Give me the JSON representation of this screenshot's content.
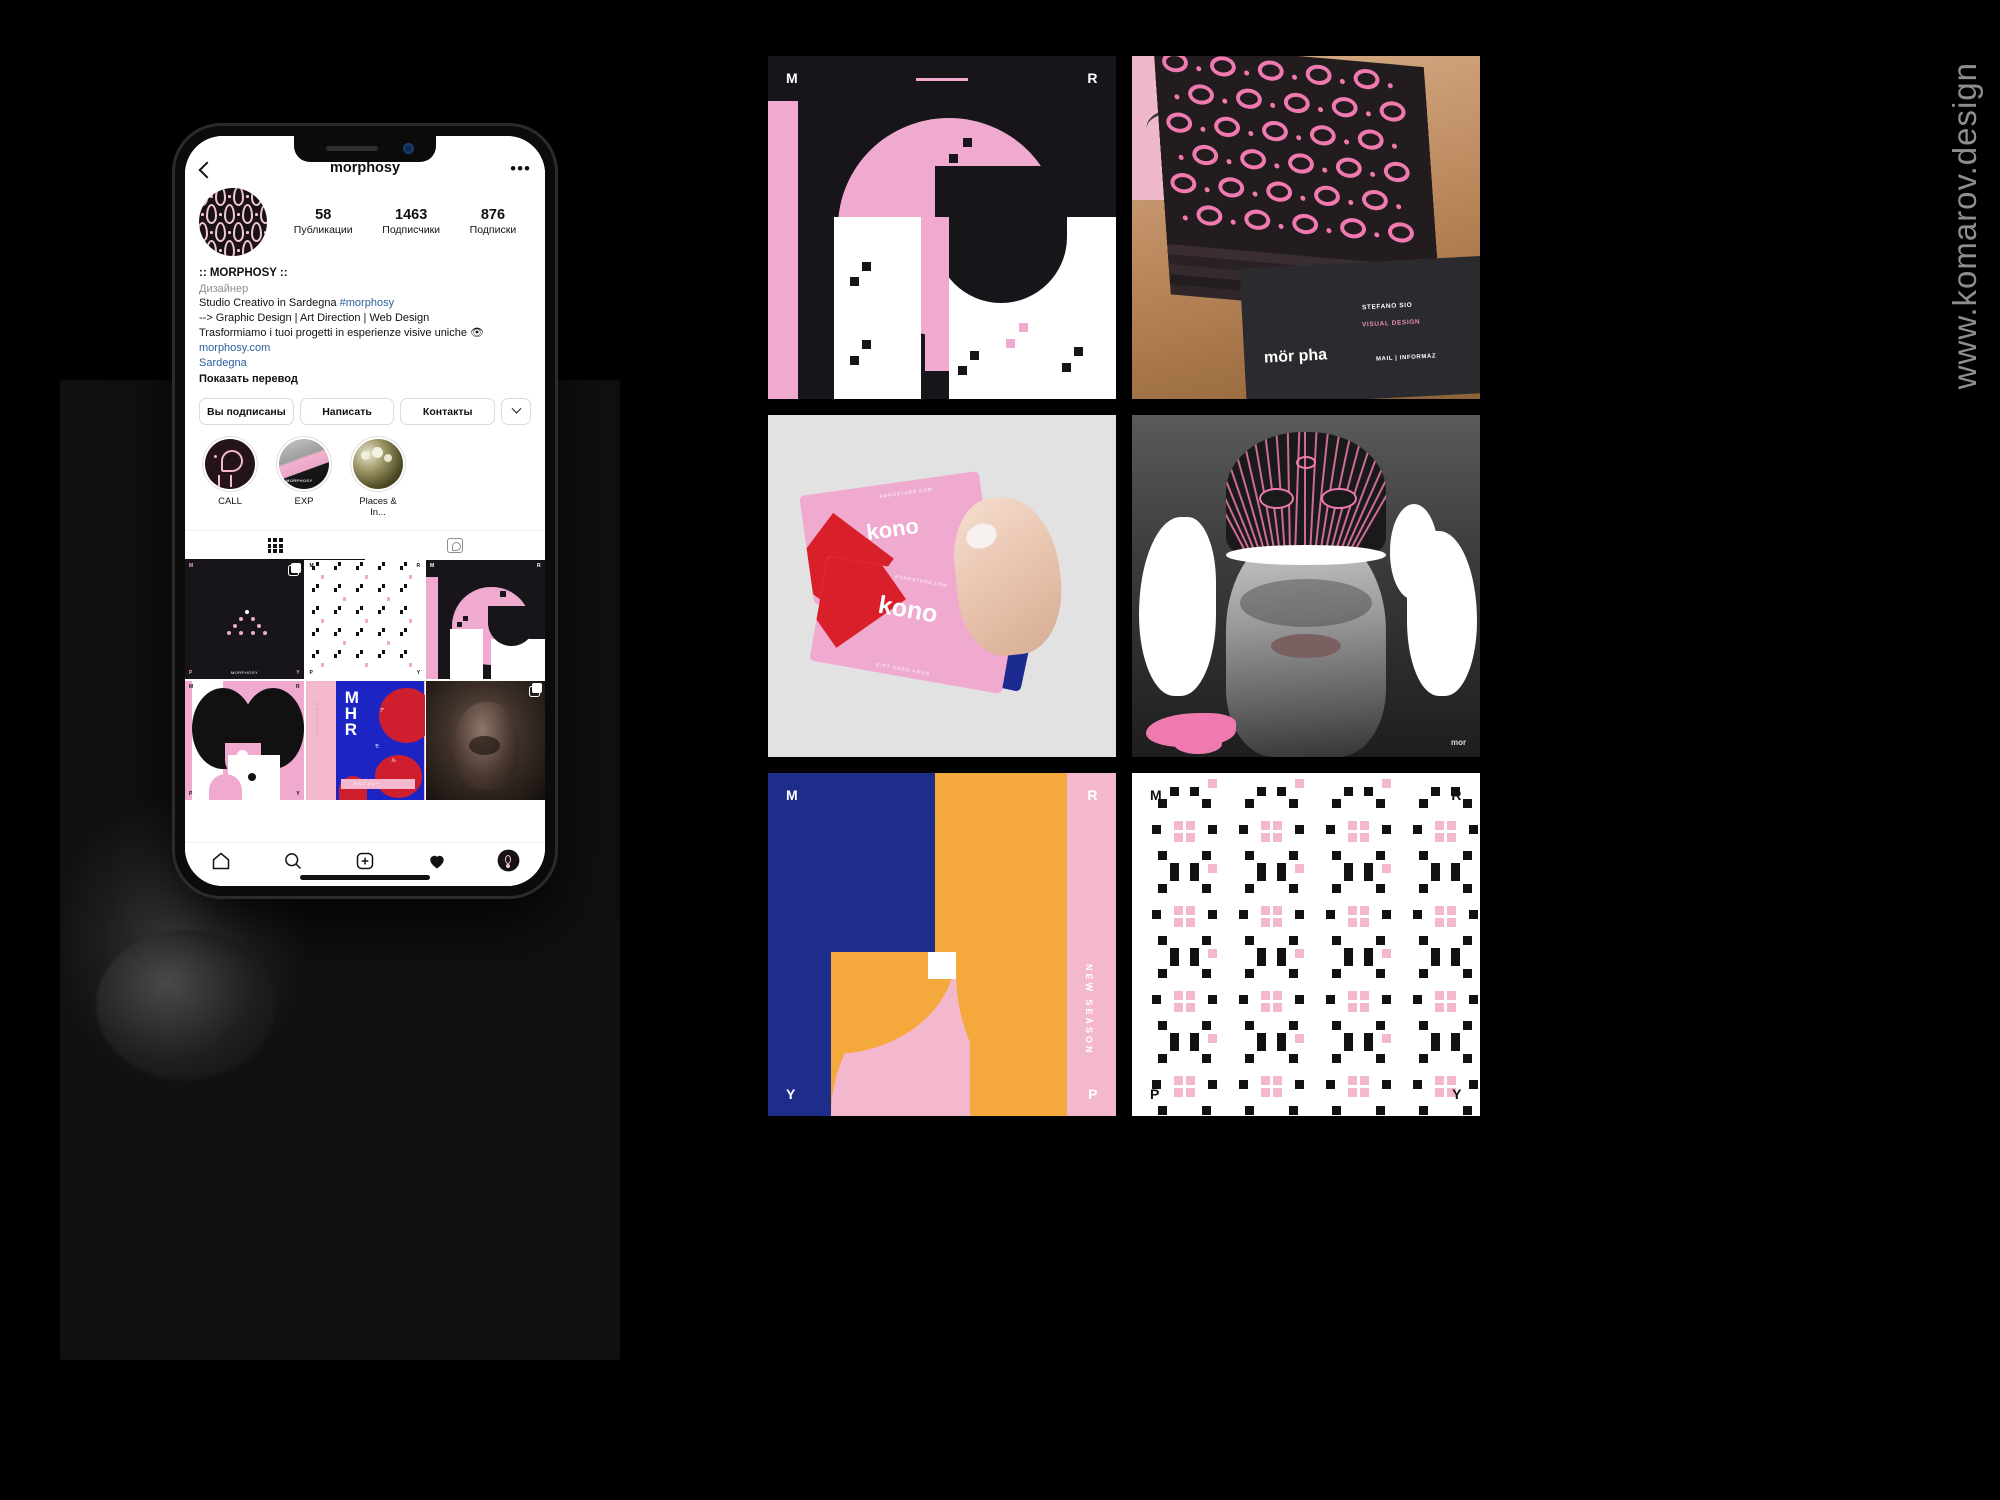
{
  "watermark": "www.komarov.design",
  "handle": "@morphosy",
  "colors": {
    "pink": "#f0aad0",
    "dark": "#17141a",
    "blue": "#1f2d8a",
    "orange": "#f5a83c",
    "red": "#d81f2a",
    "ig_link": "#2b5f9e",
    "ig_gray": "#8e8e8e"
  },
  "phone": {
    "header": {
      "back_icon": "back-chevron-icon",
      "title": "morphosy",
      "more_icon": "more-options-icon"
    },
    "profile": {
      "avatar_alt": "morphosy-avatar",
      "stats": [
        {
          "value": "58",
          "label": "Публикации"
        },
        {
          "value": "1463",
          "label": "Подписчики"
        },
        {
          "value": "876",
          "label": "Подписки"
        }
      ],
      "bio": {
        "name": ":: MORPHOSY ::",
        "category": "Дизайнер",
        "line1_text": "Studio Creativo in Sardegna ",
        "line1_tag": "#morphosy",
        "line2": "--> Graphic Design | Art Direction | Web Design",
        "line3": " Trasformiamo i tuoi progetti in esperienze visive uniche 👁",
        "website": "morphosy.com",
        "location": "Sardegna",
        "translate": "Показать перевод"
      },
      "actions": [
        {
          "label": "Вы подписаны"
        },
        {
          "label": "Написать"
        },
        {
          "label": "Контакты"
        }
      ],
      "expand_icon": "chevron-down-icon",
      "highlights": [
        {
          "label": "CALL"
        },
        {
          "label": "EXP"
        },
        {
          "label": "Places & In..."
        }
      ],
      "tabs": [
        {
          "icon": "grid-icon",
          "active": true
        },
        {
          "icon": "tagged-icon",
          "active": false
        }
      ]
    },
    "grid": [
      {
        "id": "post-1",
        "type": "dark-dots",
        "corner_tl": "M",
        "corner_bl": "P",
        "corner_br": "Y",
        "corner_center": "MORPHOSY",
        "multi": true
      },
      {
        "id": "post-2",
        "type": "white-pattern",
        "corner_tl": "M",
        "corner_tr": "R",
        "corner_bl": "P",
        "corner_br": "Y"
      },
      {
        "id": "post-3",
        "type": "pink-geometric",
        "corner_tl": "M",
        "corner_tr": "R"
      },
      {
        "id": "post-4",
        "type": "black-pink-circles",
        "corner_tl": "M",
        "corner_tr": "R",
        "corner_bl": "P",
        "corner_br": "Y"
      },
      {
        "id": "post-5",
        "type": "blue-mhr-poster"
      },
      {
        "id": "post-6",
        "type": "portrait-photo",
        "multi": true
      }
    ],
    "bottom_nav": [
      {
        "icon": "home-icon"
      },
      {
        "icon": "search-icon"
      },
      {
        "icon": "create-post-icon"
      },
      {
        "icon": "heart-icon"
      },
      {
        "icon": "profile-avatar-icon"
      }
    ]
  },
  "gallery": [
    {
      "id": "tile-geometric-dark",
      "type": "pink-geometric",
      "labels": {
        "top_left": "M",
        "top_right": "R"
      }
    },
    {
      "id": "tile-business-cards",
      "type": "photo-business-cards",
      "card_text": {
        "logo": "mör pha",
        "name": "STEFANO SIO",
        "role": "VISUAL DESIGN",
        "mail": "MAIL | INFORMAZ"
      }
    },
    {
      "id": "tile-kono-cards",
      "type": "kono-giftcards",
      "card_text": {
        "top_small": "KONOSTORE.COM",
        "big": "kono",
        "mid_small": "KONOSTORE.COM",
        "bottom": "GIFT CARD KONO"
      }
    },
    {
      "id": "tile-portrait-lines",
      "type": "portrait-pink-linework",
      "watermark": "mor"
    },
    {
      "id": "tile-new-season",
      "type": "blue-orange-geometric",
      "labels": {
        "top_left": "M",
        "top_right": "R",
        "bottom_left": "Y",
        "bottom_right": "P"
      },
      "vertical_text": "NEW SEASON"
    },
    {
      "id": "tile-dot-pattern",
      "type": "white-dot-pattern",
      "labels": {
        "top_left": "M",
        "top_right": "R",
        "bottom_left": "P",
        "bottom_right": "Y"
      }
    }
  ]
}
